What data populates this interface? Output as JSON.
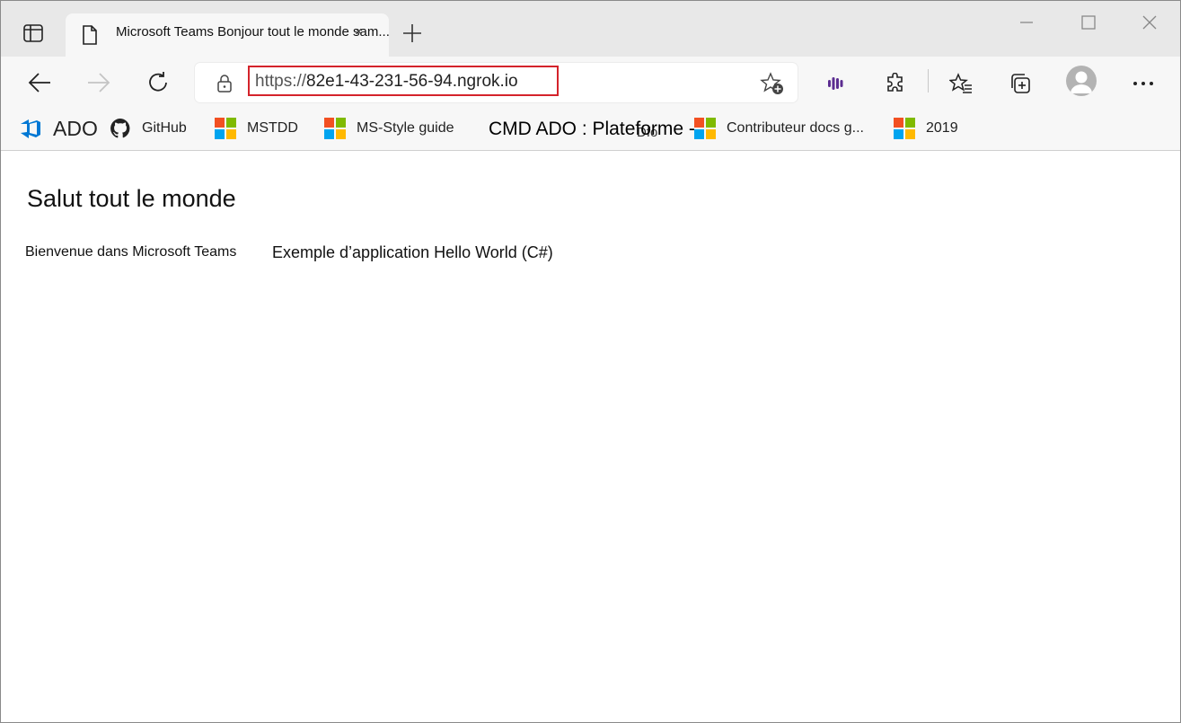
{
  "tab": {
    "title": "Microsoft Teams Bonjour tout le monde sam...",
    "close": "×",
    "newtab": "+"
  },
  "address": {
    "scheme": "https://",
    "host": "82e1-43-231-56-94.ngrok.io"
  },
  "favorites": {
    "ado": "ADO",
    "github": "GitHub",
    "mstdd": "MSTDD",
    "msstyle": "MS-Style guide",
    "cmd": "CMD ADO : Plateforme -",
    "dfo": "Dfo",
    "contrib": "Contributeur docs g...",
    "y2019": "2019"
  },
  "content": {
    "heading": "Salut tout le monde",
    "welcome": "Bienvenue dans Microsoft Teams",
    "sample": "Exemple d’application Hello World (C#)"
  },
  "colors": {
    "highlight": "#d4232b",
    "ms_red": "#f25022",
    "ms_green": "#7fba00",
    "ms_blue": "#00a4ef",
    "ms_yellow": "#ffb900",
    "ado_blue": "#0078d4",
    "extension_purple": "#5c2d91"
  }
}
